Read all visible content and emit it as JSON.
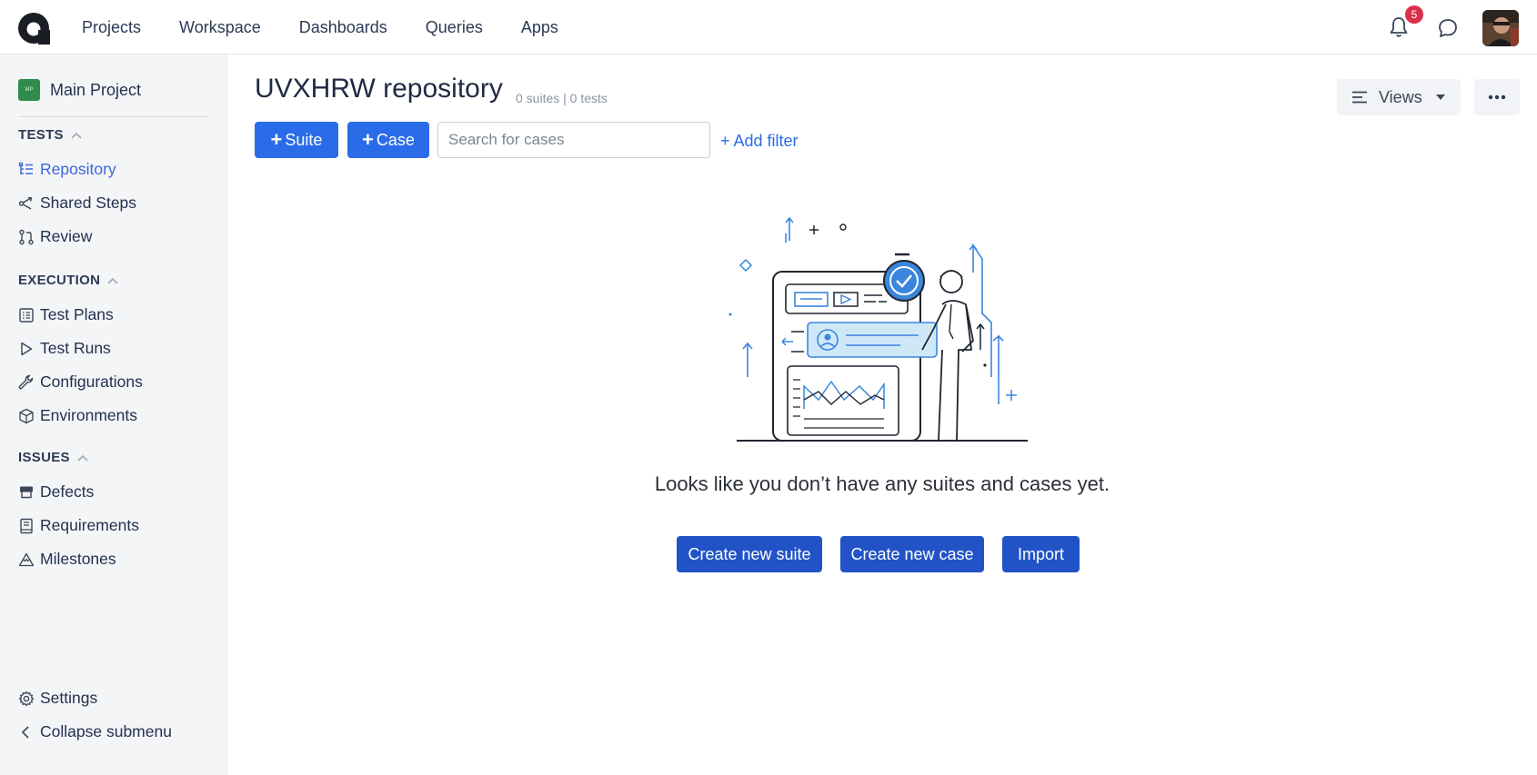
{
  "topnav": {
    "items": [
      "Projects",
      "Workspace",
      "Dashboards",
      "Queries",
      "Apps"
    ],
    "notification_count": "5"
  },
  "sidebar": {
    "project": {
      "initials": "MP",
      "name": "Main Project",
      "color": "#2f8c4a"
    },
    "sections": [
      {
        "title": "TESTS",
        "items": [
          "Repository",
          "Shared Steps",
          "Review"
        ]
      },
      {
        "title": "EXECUTION",
        "items": [
          "Test Plans",
          "Test Runs",
          "Configurations",
          "Environments"
        ]
      },
      {
        "title": "ISSUES",
        "items": [
          "Defects",
          "Requirements",
          "Milestones"
        ]
      }
    ],
    "active_item": "Repository",
    "footer": {
      "settings": "Settings",
      "collapse": "Collapse submenu"
    }
  },
  "main": {
    "title": "UVXHRW repository",
    "counts": "0 suites | 0 tests",
    "suite_button": "Suite",
    "case_button": "Case",
    "search_placeholder": "Search for cases",
    "add_filter": "+ Add filter",
    "views_button": "Views",
    "empty_message": "Looks like you don’t have any suites and cases yet.",
    "actions": {
      "create_suite": "Create new suite",
      "create_case": "Create new case",
      "import": "Import"
    }
  },
  "colors": {
    "primary": "#2a6ce8",
    "primary_dark": "#2153c7",
    "active_nav": "#3d68d8",
    "badge": "#d9304a"
  }
}
